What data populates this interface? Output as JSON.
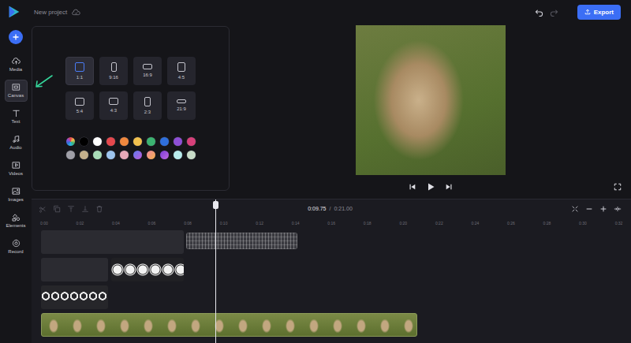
{
  "topbar": {
    "project_name": "New project",
    "export_label": "Export"
  },
  "sidebar": {
    "items": [
      {
        "label": "Media",
        "selected": false
      },
      {
        "label": "Canvas",
        "selected": true
      },
      {
        "label": "Text",
        "selected": false
      },
      {
        "label": "Audio",
        "selected": false
      },
      {
        "label": "Videos",
        "selected": false
      },
      {
        "label": "Images",
        "selected": false
      },
      {
        "label": "Elements",
        "selected": false
      },
      {
        "label": "Record",
        "selected": false
      }
    ]
  },
  "canvas_panel": {
    "ratios": [
      {
        "label": "1:1",
        "selected": true
      },
      {
        "label": "9:16",
        "selected": false
      },
      {
        "label": "16:9",
        "selected": false
      },
      {
        "label": "4:5",
        "selected": false
      },
      {
        "label": "5:4",
        "selected": false
      },
      {
        "label": "4:3",
        "selected": false
      },
      {
        "label": "2:3",
        "selected": false
      },
      {
        "label": "21:9",
        "selected": false
      }
    ],
    "swatches": [
      {
        "kind": "picker"
      },
      {
        "kind": "solid",
        "color": "#000000"
      },
      {
        "kind": "solid",
        "color": "#ffffff"
      },
      {
        "kind": "solid",
        "color": "#e5484d"
      },
      {
        "kind": "solid",
        "color": "#f0883e"
      },
      {
        "kind": "solid",
        "color": "#f2c14e"
      },
      {
        "kind": "solid",
        "color": "#3cb371"
      },
      {
        "kind": "solid",
        "color": "#2f6fdb"
      },
      {
        "kind": "solid",
        "color": "#8e4fd6"
      },
      {
        "kind": "solid",
        "color": "#d6407a"
      },
      {
        "kind": "solid",
        "color": "#a0a0a8"
      },
      {
        "kind": "solid",
        "color": "#c4b08c"
      },
      {
        "kind": "solid",
        "color": "#a8dcb8"
      },
      {
        "kind": "solid",
        "color": "#9cc4ee"
      },
      {
        "kind": "solid",
        "color": "#e6a8b8"
      },
      {
        "kind": "gradient",
        "colors": [
          "#5b7cf0",
          "#c05ad8"
        ]
      },
      {
        "kind": "gradient",
        "colors": [
          "#f08aa0",
          "#f4b04a"
        ]
      },
      {
        "kind": "gradient",
        "colors": [
          "#7a3cd6",
          "#c06ae0"
        ]
      },
      {
        "kind": "solid",
        "color": "#b8ecec"
      },
      {
        "kind": "solid",
        "color": "#c8dcc8"
      }
    ]
  },
  "timeline": {
    "current_time": "0:09.75",
    "separator": "/",
    "total_time": "0:21.00",
    "playhead_seconds": 9.75,
    "ruler": [
      "0:00",
      "0:02",
      "0:04",
      "0:06",
      "0:08",
      "0:10",
      "0:12",
      "0:14",
      "0:16",
      "0:18",
      "0:20",
      "0:22",
      "0:24",
      "0:26",
      "0:28",
      "0:30",
      "0:32"
    ],
    "tracks": [
      {
        "clips": [
          {
            "kind": "gap",
            "start": 0.04,
            "end": 7.99
          },
          {
            "kind": "texture",
            "start": 8.12,
            "end": 14.32
          }
        ]
      },
      {
        "clips": [
          {
            "kind": "gap",
            "start": 0.04,
            "end": 3.78
          },
          {
            "kind": "circles",
            "start": 3.95,
            "end": 7.99
          }
        ]
      },
      {
        "clips": [
          {
            "kind": "symbols",
            "start": 0.04,
            "end": 3.78
          }
        ]
      },
      {
        "clips": [
          {
            "kind": "video",
            "start": 0.04,
            "end": 20.99
          }
        ]
      }
    ]
  }
}
